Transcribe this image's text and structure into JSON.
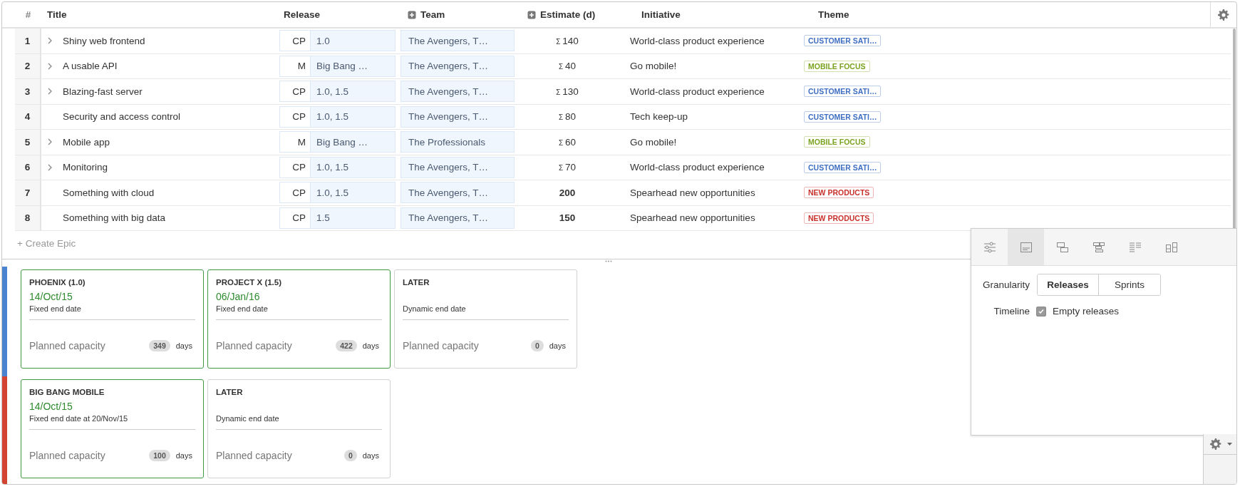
{
  "columns": [
    {
      "label": "#",
      "expandable": false
    },
    {
      "label": "Title",
      "expandable": false
    },
    {
      "label": "Release",
      "expandable": false
    },
    {
      "label": "Team",
      "expandable": true
    },
    {
      "label": "Estimate (d)",
      "expandable": true
    },
    {
      "label": "Initiative",
      "expandable": false
    },
    {
      "label": "Theme",
      "expandable": false
    }
  ],
  "rows": [
    {
      "number": "1",
      "expandable": true,
      "title": "Shiny web frontend",
      "release_type": "CP",
      "release": "1.0",
      "team": "The Avengers, T…",
      "summed": true,
      "estimate_symbol": "Σ",
      "estimate": "140",
      "initiative": "World-class product experience",
      "theme": {
        "label": "CUSTOMER SATI…",
        "color": "#3f6fc2"
      }
    },
    {
      "number": "2",
      "expandable": true,
      "title": "A usable API",
      "release_type": "M",
      "release": "Big Bang …",
      "team": "The Avengers, T…",
      "summed": true,
      "estimate_symbol": "Σ",
      "estimate": "40",
      "initiative": "Go mobile!",
      "theme": {
        "label": "MOBILE FOCUS",
        "color": "#7ba320"
      }
    },
    {
      "number": "3",
      "expandable": true,
      "title": "Blazing-fast server",
      "release_type": "CP",
      "release": "1.0, 1.5",
      "team": "The Avengers, T…",
      "summed": true,
      "estimate_symbol": "Σ",
      "estimate": "130",
      "initiative": "World-class product experience",
      "theme": {
        "label": "CUSTOMER SATI…",
        "color": "#3f6fc2"
      }
    },
    {
      "number": "4",
      "expandable": false,
      "title": "Security and access control",
      "release_type": "CP",
      "release": "1.0, 1.5",
      "team": "The Avengers, T…",
      "summed": true,
      "estimate_symbol": "Σ",
      "estimate": "80",
      "initiative": "Tech keep-up",
      "theme": {
        "label": "CUSTOMER SATI…",
        "color": "#3f6fc2"
      }
    },
    {
      "number": "5",
      "expandable": true,
      "title": "Mobile app",
      "release_type": "M",
      "release": "Big Bang …",
      "team": "The Professionals",
      "summed": true,
      "estimate_symbol": "Σ",
      "estimate": "60",
      "initiative": "Go mobile!",
      "theme": {
        "label": "MOBILE FOCUS",
        "color": "#7ba320"
      }
    },
    {
      "number": "6",
      "expandable": true,
      "title": "Monitoring",
      "release_type": "CP",
      "release": "1.0, 1.5",
      "team": "The Avengers, T…",
      "summed": true,
      "estimate_symbol": "Σ",
      "estimate": "70",
      "initiative": "World-class product experience",
      "theme": {
        "label": "CUSTOMER SATI…",
        "color": "#3f6fc2"
      }
    },
    {
      "number": "7",
      "expandable": false,
      "title": "Something with cloud",
      "release_type": "CP",
      "release": "1.0, 1.5",
      "team": "The Avengers, T…",
      "summed": false,
      "estimate": "200",
      "initiative": "Spearhead new opportunities",
      "theme": {
        "label": "NEW PRODUCTS",
        "color": "#c9302c"
      }
    },
    {
      "number": "8",
      "expandable": false,
      "title": "Something with big data",
      "release_type": "CP",
      "release": "1.5",
      "team": "The Avengers, T…",
      "summed": false,
      "estimate": "150",
      "initiative": "Spearhead new opportunities",
      "theme": {
        "label": "NEW PRODUCTS",
        "color": "#c9302c"
      }
    }
  ],
  "create_link": "+ Create Epic",
  "lanes": [
    {
      "color": "#4a84d0",
      "cards": [
        {
          "title": "PHOENIX (1.0)",
          "fixed": true,
          "date": "14/Oct/15",
          "end": "Fixed end date",
          "capacity_label": "Planned capacity",
          "capacity": "349",
          "unit": "days"
        },
        {
          "title": "PROJECT X (1.5)",
          "fixed": true,
          "date": "06/Jan/16",
          "end": "Fixed end date",
          "capacity_label": "Planned capacity",
          "capacity": "422",
          "unit": "days"
        },
        {
          "title": "LATER",
          "fixed": false,
          "end": "Dynamic end date",
          "capacity_label": "Planned capacity",
          "capacity": "0",
          "unit": "days"
        }
      ]
    },
    {
      "color": "#d2442f",
      "cards": [
        {
          "title": "BIG BANG MOBILE",
          "fixed": true,
          "date": "14/Oct/15",
          "end": "Fixed end date at 20/Nov/15",
          "capacity_label": "Planned capacity",
          "capacity": "100",
          "unit": "days"
        },
        {
          "title": "LATER",
          "fixed": false,
          "end": "Dynamic end date",
          "capacity_label": "Planned capacity",
          "capacity": "0",
          "unit": "days"
        }
      ]
    }
  ],
  "panel": {
    "tabs": [
      {
        "kind": "sliders",
        "selected": false
      },
      {
        "kind": "card",
        "selected": true
      },
      {
        "kind": "stack",
        "selected": false
      },
      {
        "kind": "tree",
        "selected": false
      },
      {
        "kind": "list",
        "selected": false
      },
      {
        "kind": "columns",
        "selected": false
      }
    ],
    "granularity_label": "Granularity",
    "granularity": [
      {
        "label": "Releases",
        "selected": true
      },
      {
        "label": "Sprints",
        "selected": false
      }
    ],
    "timeline_label": "Timeline",
    "timeline_option": {
      "label": "Empty releases",
      "checked": true
    }
  }
}
